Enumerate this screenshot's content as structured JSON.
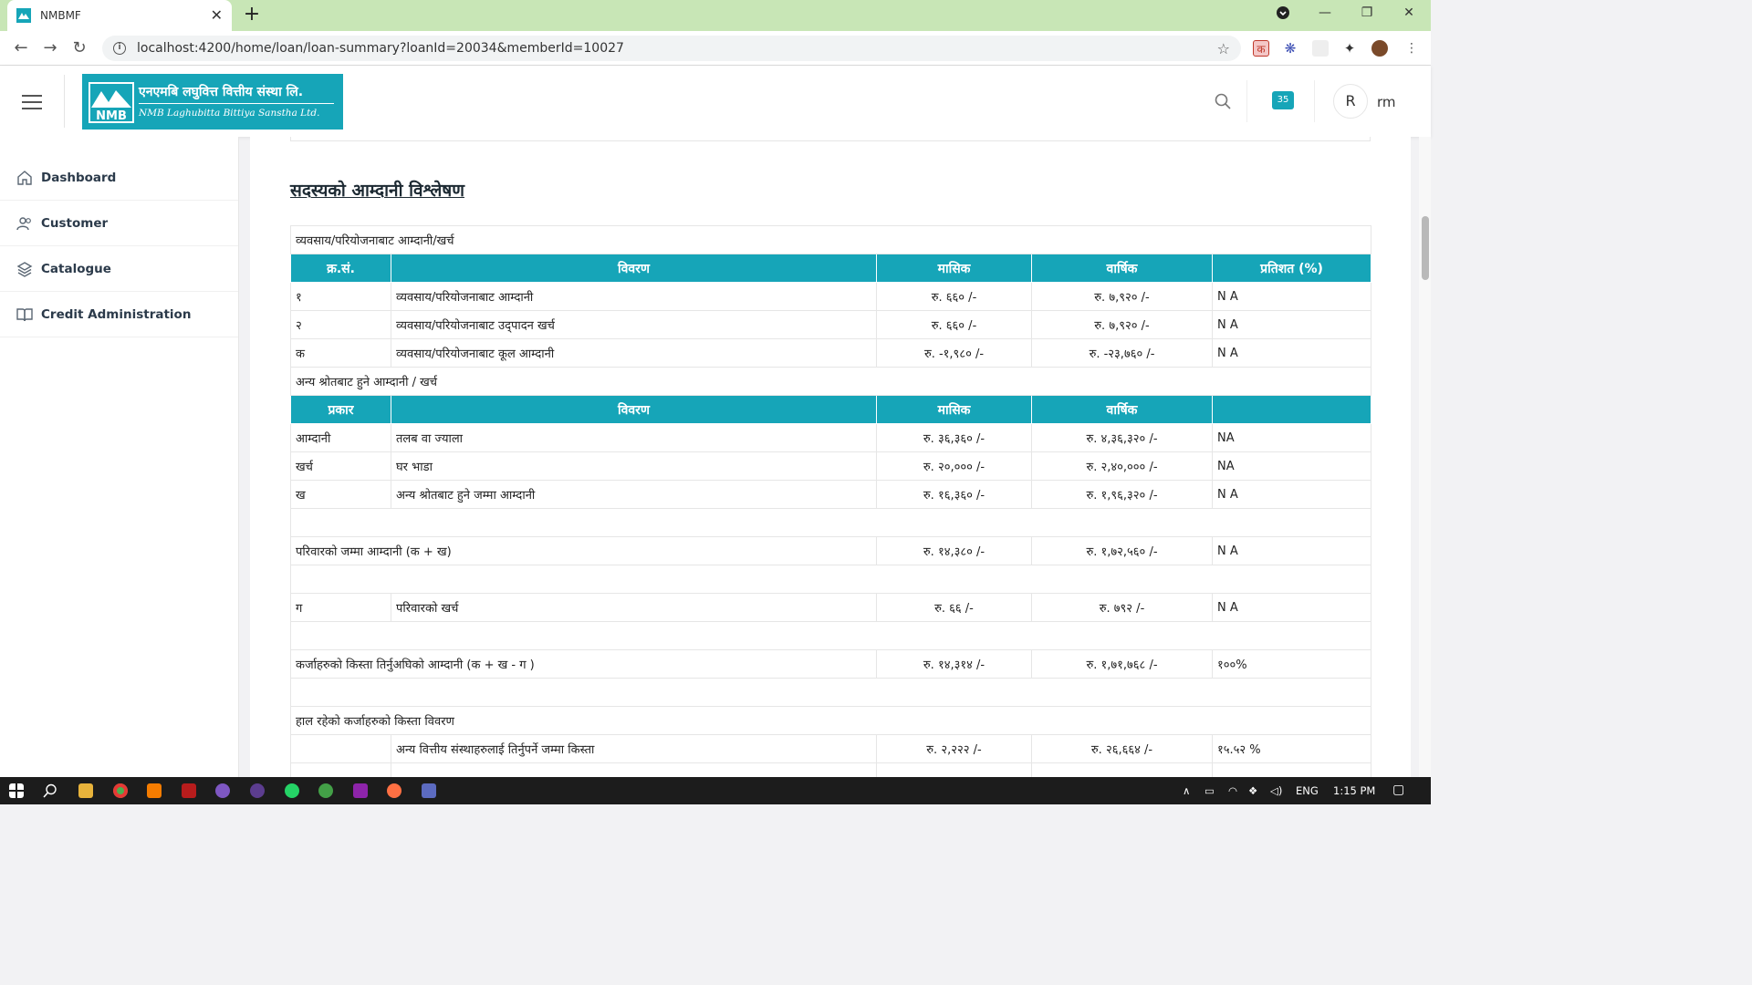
{
  "browser": {
    "tab_title": "NMBMF",
    "tab_close": "✕",
    "new_tab": "+",
    "url": "localhost:4200/home/loan/loan-summary?loanId=20034&memberId=10027",
    "ext_badge": "क"
  },
  "header": {
    "logo_nepali": "एनएमबि लघुवित्त वित्तीय संस्था लि.",
    "logo_english": "NMB Laghubitta Bittiya Sanstha Ltd.",
    "logo_mark": "NMB",
    "notification_count": "35",
    "avatar_initial": "R",
    "user_name": "rm"
  },
  "sidebar": {
    "items": [
      {
        "label": "Dashboard",
        "icon": "home-icon"
      },
      {
        "label": "Customer",
        "icon": "users-icon"
      },
      {
        "label": "Catalogue",
        "icon": "layers-icon"
      },
      {
        "label": "Credit Administration",
        "icon": "book-icon"
      }
    ]
  },
  "main": {
    "section_title": "सदस्यको आम्दानी विश्लेषण",
    "business_group_title": "व्यवसाय/परियोजनाबाट आम्दानी/खर्च",
    "business_headers": [
      "क्र.सं.",
      "विवरण",
      "मासिक",
      "वार्षिक",
      "प्रतिशत (%)"
    ],
    "business_rows": [
      [
        "१",
        "व्यवसाय/परियोजनाबाट आम्दानी",
        "रु. ६६० /-",
        "रु. ७,९२० /-",
        "N A"
      ],
      [
        "२",
        "व्यवसाय/परियोजनाबाट उद्पादन खर्च",
        "रु. ६६० /-",
        "रु. ७,९२० /-",
        "N A"
      ],
      [
        "क",
        "व्यवसाय/परियोजनाबाट कूल आम्दानी",
        "रु. -१,९८० /-",
        "रु. -२३,७६० /-",
        "N A"
      ]
    ],
    "other_group_title": "अन्य श्रोतबाट हुने आम्दानी / खर्च",
    "other_headers": [
      "प्रकार",
      "विवरण",
      "मासिक",
      "वार्षिक",
      ""
    ],
    "other_rows": [
      [
        "आम्दानी",
        "तलब वा ज्याला",
        "रु. ३६,३६० /-",
        "रु. ४,३६,३२० /-",
        "NA"
      ],
      [
        "खर्च",
        "घर भाडा",
        "रु. २०,००० /-",
        "रु. २,४०,००० /-",
        "NA"
      ],
      [
        "ख",
        "अन्य श्रोतबाट हुने जम्मा आम्दानी",
        "रु. १६,३६० /-",
        "रु. १,९६,३२० /-",
        "N A"
      ]
    ],
    "family_total": {
      "label": "परिवारको जम्मा आम्दानी (क + ख)",
      "monthly": "रु. १४,३८० /-",
      "yearly": "रु. १,७२,५६० /-",
      "percent": "N A"
    },
    "family_expense": {
      "code": "ग",
      "label": "परिवारको खर्च",
      "monthly": "रु. ६६ /-",
      "yearly": "रु. ७९२ /-",
      "percent": "N A"
    },
    "pre_installment": {
      "label": "कर्जाहरुको किस्ता तिर्नुअघिको आम्दानी (क + ख - ग )",
      "monthly": "रु. १४,३१४ /-",
      "yearly": "रु. १,७१,७६८ /-",
      "percent": "१००%"
    },
    "installment_group_title": "हाल रहेको कर्जाहरुको किस्ता विवरण",
    "installment_rows": [
      [
        "",
        "अन्य वित्तीय संस्थाहरुलाई तिर्नुपर्ने जम्मा किस्ता",
        "रु. २,२२२ /-",
        "रु. २६,६६४ /-",
        "१५.५२ %"
      ]
    ]
  },
  "taskbar": {
    "language": "ENG",
    "time": "1:15 PM"
  },
  "colors": {
    "accent": "#16a5b8",
    "tabstrip": "#c8e6b6"
  }
}
